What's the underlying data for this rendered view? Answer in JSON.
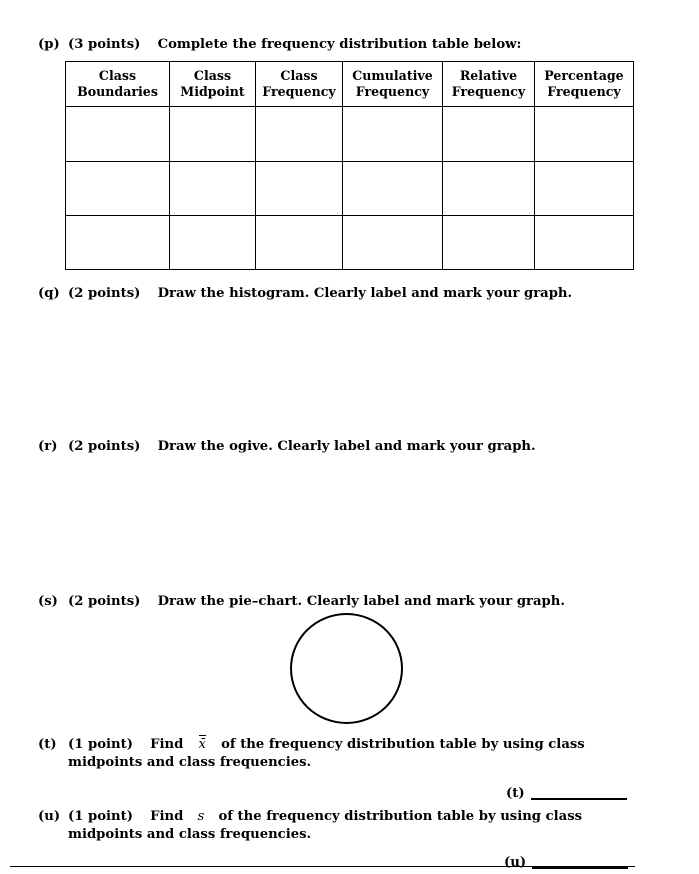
{
  "document": {
    "type": "statistics-worksheet-page",
    "background_color": "#ffffff",
    "text_color": "#000000"
  },
  "items": [
    {
      "id": "p",
      "label": "(p)",
      "points": "(3 points)",
      "text": "Complete the frequency distribution table below:"
    },
    {
      "id": "q",
      "label": "(q)",
      "points": "(2 points)",
      "text": "Draw the histogram.  Clearly label and mark your graph."
    },
    {
      "id": "r",
      "label": "(r)",
      "points": "(2 points)",
      "text": "Draw the ogive.  Clearly label and mark your graph."
    },
    {
      "id": "s",
      "label": "(s)",
      "points": "(2 points)",
      "text": "Draw the pie–chart.  Clearly label and mark your graph."
    },
    {
      "id": "t",
      "label": "(t)",
      "points": "(1 point)",
      "text_before_var": "Find",
      "variable": "x̄",
      "text_after_var": "of the frequency distribution table by using class midpoints and class frequencies."
    },
    {
      "id": "u",
      "label": "(u)",
      "points": "(1 point)",
      "text_before_var": "Find",
      "variable": "s",
      "text_after_var": "of the frequency distribution table by using class midpoints and class frequencies."
    }
  ],
  "frequency_table": {
    "columns": [
      {
        "line1": "Class",
        "line2": "Boundaries"
      },
      {
        "line1": "Class",
        "line2": "Midpoint"
      },
      {
        "line1": "Class",
        "line2": "Frequency"
      },
      {
        "line1": "Cumulative",
        "line2": "Frequency"
      },
      {
        "line1": "Relative",
        "line2": "Frequency"
      },
      {
        "line1": "Percentage",
        "line2": "Frequency"
      }
    ],
    "rows": [
      [
        "",
        "",
        "",
        "",
        "",
        ""
      ],
      [
        "",
        "",
        "",
        "",
        "",
        ""
      ],
      [
        "",
        "",
        "",
        "",
        "",
        ""
      ]
    ],
    "empty_body": true
  },
  "pie_chart_placeholder": {
    "shape": "circle",
    "filled": false,
    "stroke_color": "#000000"
  },
  "answer_blanks": [
    {
      "id": "t-answer",
      "label": "(t)",
      "value": ""
    },
    {
      "id": "u-answer",
      "label": "(u)",
      "value": ""
    }
  ]
}
